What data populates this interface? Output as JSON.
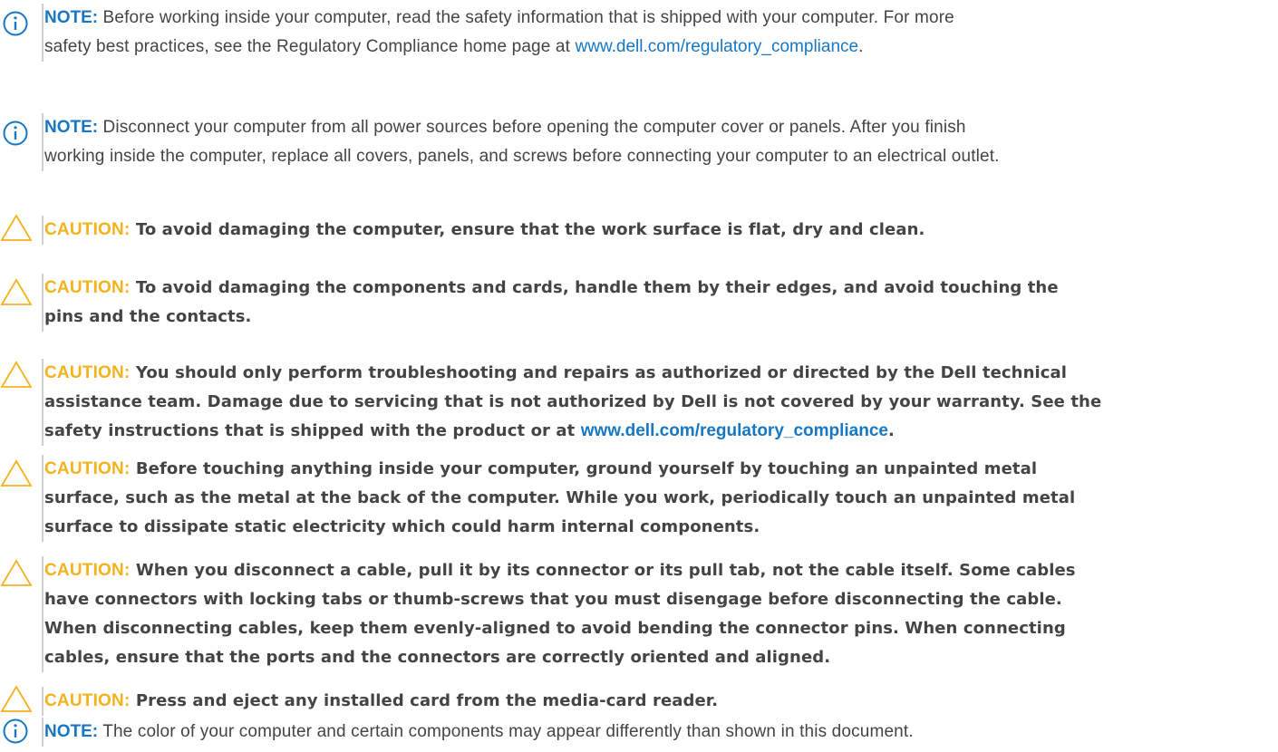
{
  "colors": {
    "note_label": "#1777c2",
    "caution_label": "#f2b31d",
    "link": "#1777c2",
    "body_text": "#444444",
    "rule": "#cfcfcf"
  },
  "icons": {
    "note": "info-circle-icon",
    "caution": "warning-triangle-icon"
  },
  "notices": [
    {
      "type": "note",
      "label": "NOTE:",
      "lines": [
        " Before working inside your computer, read the safety information that is shipped with your computer. For more",
        "safety best practices, see the Regulatory Compliance home page at "
      ],
      "link": "www.dell.com/regulatory_compliance",
      "after_link": "."
    },
    {
      "type": "note",
      "label": "NOTE:",
      "lines": [
        " Disconnect your computer from all power sources before opening the computer cover or panels. After you finish",
        "working inside the computer, replace all covers, panels, and screws before connecting your computer to an electrical outlet."
      ]
    },
    {
      "type": "caution",
      "label": "CAUTION:",
      "lines": [
        " To avoid damaging the computer, ensure that the work surface is flat, dry and clean."
      ]
    },
    {
      "type": "caution",
      "label": "CAUTION:",
      "lines": [
        " To avoid damaging the components and cards, handle them by their edges, and avoid touching the",
        "pins and the contacts."
      ]
    },
    {
      "type": "caution",
      "label": "CAUTION:",
      "lines": [
        " You should only perform troubleshooting and repairs as authorized or directed by the Dell technical",
        "assistance team. Damage due to servicing that is not authorized by Dell is not covered by your warranty. See the",
        "safety instructions that is shipped with the product or at "
      ],
      "link": "www.dell.com/regulatory_compliance",
      "after_link": "."
    },
    {
      "type": "caution",
      "label": "CAUTION:",
      "lines": [
        " Before touching anything inside your computer, ground yourself by touching an unpainted metal",
        "surface, such as the metal at the back of the computer. While you work, periodically touch an unpainted metal",
        "surface to dissipate static electricity which could harm internal components."
      ]
    },
    {
      "type": "caution",
      "label": "CAUTION:",
      "lines": [
        " When you disconnect a cable, pull it by its connector or its pull tab, not the cable itself. Some cables",
        "have connectors with locking tabs or thumb-screws that you must disengage before disconnecting the cable.",
        "When disconnecting cables, keep them evenly-aligned to avoid bending the connector pins. When connecting",
        "cables, ensure that the ports and the connectors are correctly oriented and aligned."
      ]
    },
    {
      "type": "caution",
      "label": "CAUTION:",
      "lines": [
        " Press and eject any installed card from the media-card reader."
      ]
    },
    {
      "type": "note",
      "label": "NOTE:",
      "lines": [
        " The color of your computer and certain components may appear differently than shown in this document."
      ]
    }
  ]
}
